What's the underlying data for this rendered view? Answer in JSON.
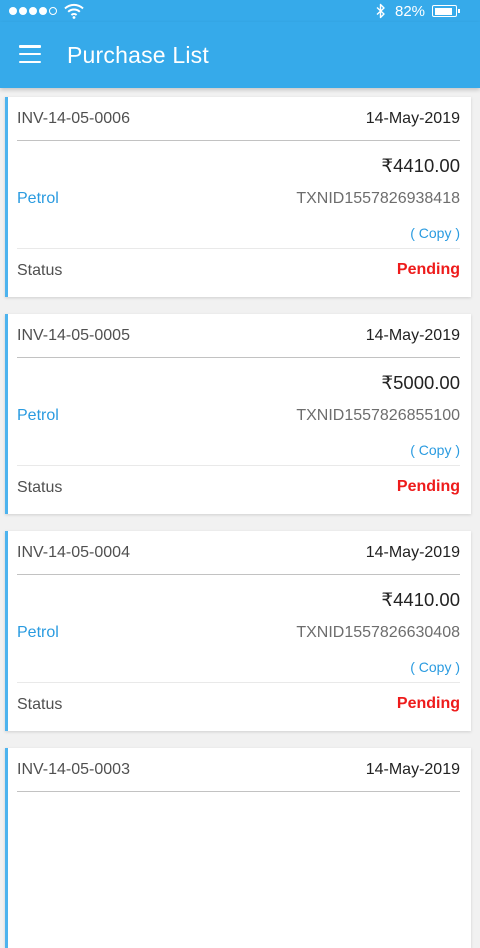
{
  "status_bar": {
    "battery_percent": "82%",
    "signal_bars_filled": 4,
    "signal_bars_total": 5
  },
  "app_bar": {
    "title": "Purchase List",
    "color": "#36aaea"
  },
  "purchases": [
    {
      "invoice": "INV-14-05-0006",
      "date": "14-May-2019",
      "amount": "₹4410.00",
      "category": "Petrol",
      "txn_id": "TXNID1557826938418",
      "copy_label": "( Copy )",
      "status_label": "Status",
      "status": "Pending"
    },
    {
      "invoice": "INV-14-05-0005",
      "date": "14-May-2019",
      "amount": "₹5000.00",
      "category": "Petrol",
      "txn_id": "TXNID1557826855100",
      "copy_label": "( Copy )",
      "status_label": "Status",
      "status": "Pending"
    },
    {
      "invoice": "INV-14-05-0004",
      "date": "14-May-2019",
      "amount": "₹4410.00",
      "category": "Petrol",
      "txn_id": "TXNID1557826630408",
      "copy_label": "( Copy )",
      "status_label": "Status",
      "status": "Pending"
    },
    {
      "invoice": "INV-14-05-0003",
      "date": "14-May-2019",
      "amount": "",
      "category": "",
      "txn_id": "",
      "copy_label": "",
      "status_label": "",
      "status": ""
    }
  ]
}
